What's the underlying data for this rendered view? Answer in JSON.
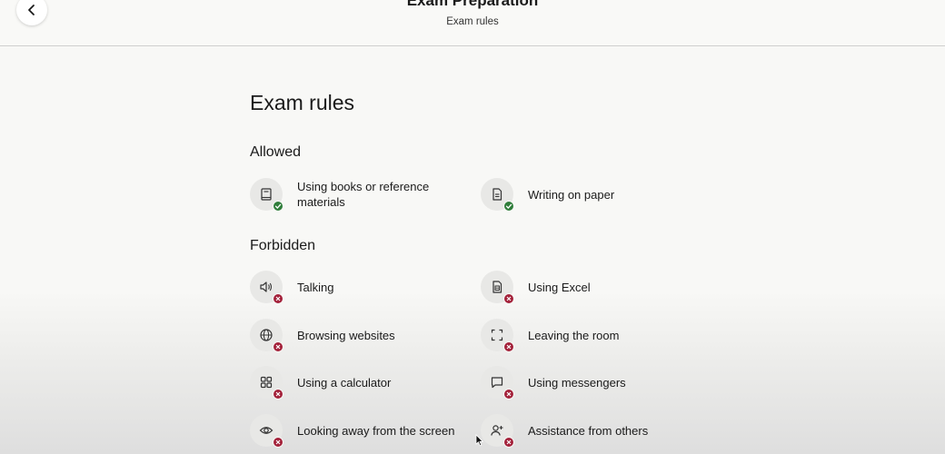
{
  "header": {
    "title": "Exam Preparation",
    "subtitle": "Exam rules"
  },
  "main": {
    "title": "Exam rules",
    "allowed": {
      "heading": "Allowed",
      "items": [
        {
          "label": "Using books or reference materials",
          "icon": "book-icon"
        },
        {
          "label": "Writing on paper",
          "icon": "document-icon"
        }
      ]
    },
    "forbidden": {
      "heading": "Forbidden",
      "items": [
        {
          "label": "Talking",
          "icon": "speaker-icon"
        },
        {
          "label": "Using Excel",
          "icon": "spreadsheet-icon"
        },
        {
          "label": "Browsing websites",
          "icon": "globe-icon"
        },
        {
          "label": "Leaving the room",
          "icon": "fullscreen-icon"
        },
        {
          "label": "Using a calculator",
          "icon": "grid-icon"
        },
        {
          "label": "Using messengers",
          "icon": "chat-icon"
        },
        {
          "label": "Looking away from the screen",
          "icon": "eye-icon"
        },
        {
          "label": "Assistance from others",
          "icon": "add-person-icon"
        }
      ]
    }
  },
  "colors": {
    "allowed_badge": "#2f7d3a",
    "forbidden_badge": "#a3213a"
  }
}
